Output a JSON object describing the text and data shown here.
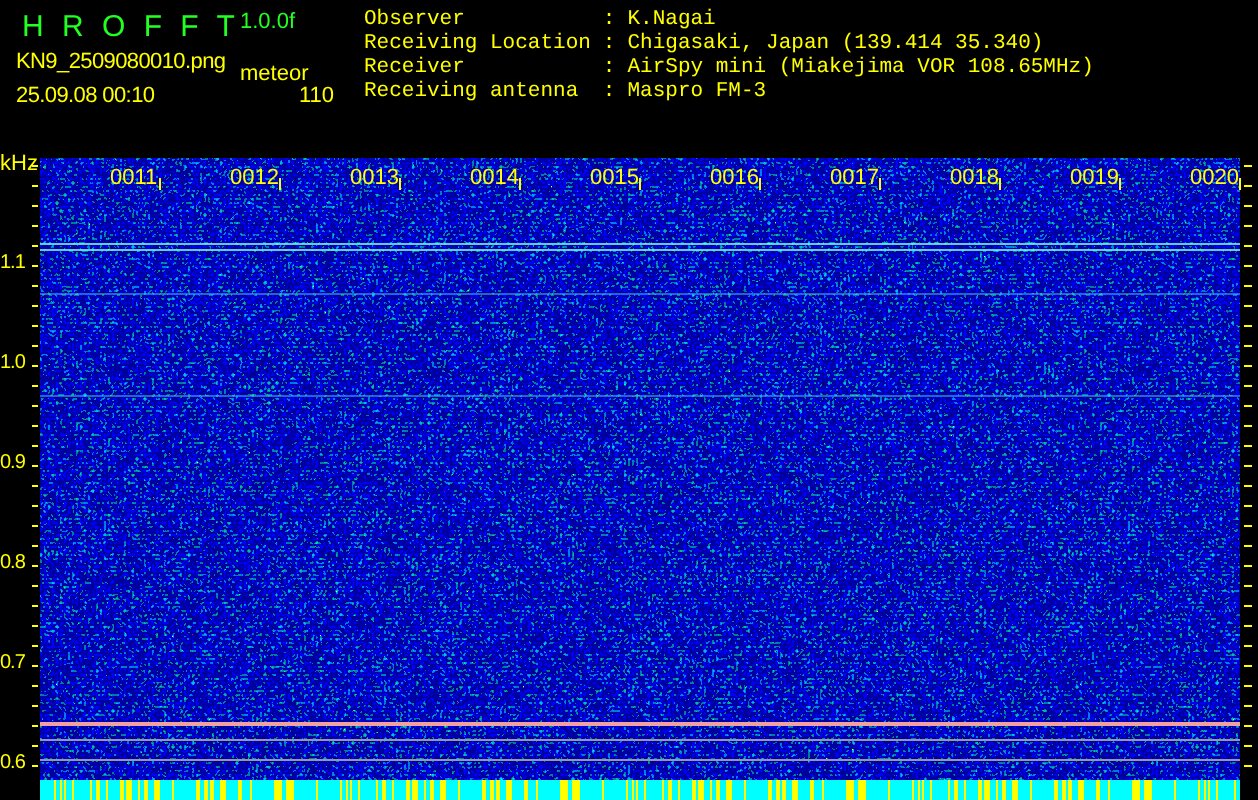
{
  "header": {
    "title": "H R O F F T",
    "version": "1.0.0f",
    "filename": "KN9_2509080010.png",
    "mode": "meteor",
    "date": "25.09.08 00:10",
    "count": "110"
  },
  "info": [
    {
      "label": "Observer",
      "separator": ":",
      "value": "K.Nagai"
    },
    {
      "label": "Receiving Location",
      "separator": ":",
      "value": "Chigasaki, Japan (139.414 35.340)"
    },
    {
      "label": "Receiver",
      "separator": ":",
      "value": "AirSpy mini (Miakejima VOR 108.65MHz)"
    },
    {
      "label": "Receiving antenna",
      "separator": ":",
      "value": "Maspro FM-3"
    }
  ],
  "spectrogram": {
    "unit": "kHz",
    "time_labels": [
      "0011",
      "0012",
      "0013",
      "0014",
      "0015",
      "0016",
      "0017",
      "0018",
      "0019",
      "0020"
    ],
    "frequency_labels": [
      "1.1",
      "1.0",
      "0.9",
      "0.8",
      "0.7",
      "0.6"
    ]
  }
}
